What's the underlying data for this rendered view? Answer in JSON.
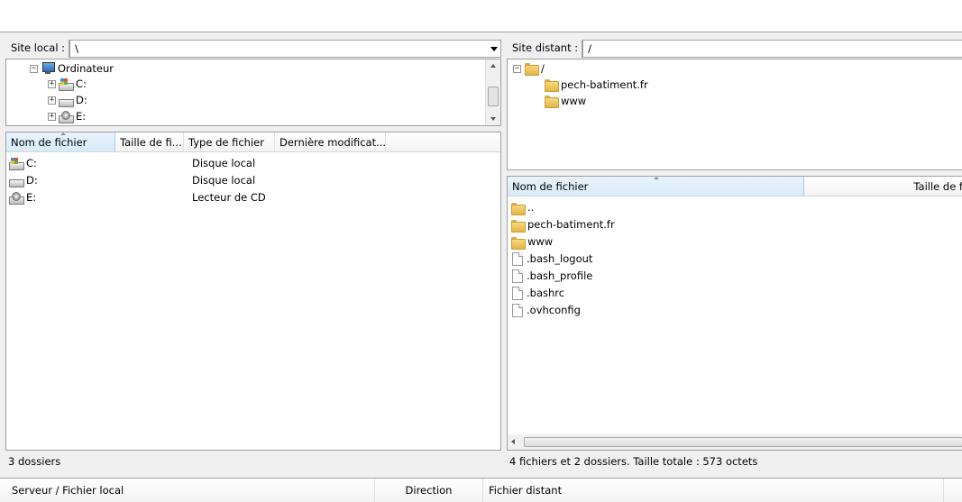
{
  "local": {
    "site_label": "Site local :",
    "path": "\\",
    "tree": [
      {
        "label": "Ordinateur",
        "expander": "−"
      },
      {
        "label": "C:",
        "expander": "+"
      },
      {
        "label": "D:",
        "expander": "+"
      },
      {
        "label": "E:",
        "expander": "+"
      }
    ],
    "columns": [
      "Nom de fichier",
      "Taille de fi...",
      "Type de fichier",
      "Dernière modificat..."
    ],
    "rows": [
      {
        "name": "C:",
        "type": "Disque local",
        "icon": "system-drive-icon"
      },
      {
        "name": "D:",
        "type": "Disque local",
        "icon": "drive-icon"
      },
      {
        "name": "E:",
        "type": "Lecteur de CD",
        "icon": "cd-drive-icon"
      }
    ],
    "status": "3 dossiers"
  },
  "remote": {
    "site_label": "Site distant :",
    "path": "/",
    "tree": [
      {
        "label": "/",
        "expander": "−"
      },
      {
        "label": "pech-batiment.fr"
      },
      {
        "label": "www"
      }
    ],
    "columns": [
      "Nom de fichier",
      "Taille de f"
    ],
    "rows": [
      {
        "name": "..",
        "icon": "folder-icon"
      },
      {
        "name": "pech-batiment.fr",
        "icon": "folder-icon"
      },
      {
        "name": "www",
        "icon": "folder-icon"
      },
      {
        "name": ".bash_logout",
        "icon": "file-icon"
      },
      {
        "name": ".bash_profile",
        "icon": "file-icon"
      },
      {
        "name": ".bashrc",
        "icon": "file-icon"
      },
      {
        "name": ".ovhconfig",
        "icon": "file-icon"
      }
    ],
    "status": "4 fichiers et 2 dossiers. Taille totale : 573 octets"
  },
  "queue": {
    "columns": [
      "Serveur / Fichier local",
      "Direction",
      "Fichier distant"
    ]
  }
}
